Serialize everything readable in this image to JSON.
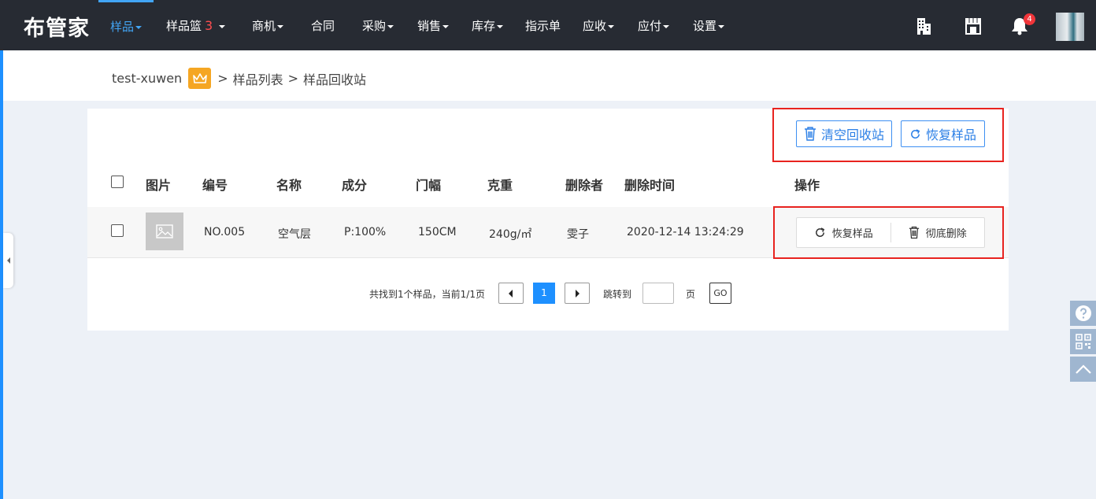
{
  "app": {
    "logo": "布管家"
  },
  "nav": {
    "items": [
      {
        "label": "样品",
        "caret": true,
        "active": true
      },
      {
        "label": "样品篮",
        "badge": "3",
        "caret": true
      },
      {
        "label": "商机",
        "caret": true
      },
      {
        "label": "合同",
        "caret": false
      },
      {
        "label": "采购",
        "caret": true
      },
      {
        "label": "销售",
        "caret": true
      },
      {
        "label": "库存",
        "caret": true
      },
      {
        "label": "指示单",
        "caret": false
      },
      {
        "label": "应收",
        "caret": true
      },
      {
        "label": "应付",
        "caret": true
      },
      {
        "label": "设置",
        "caret": true
      }
    ],
    "icons": [
      "building-icon",
      "store-icon",
      "bell-icon"
    ],
    "notification_count": "4"
  },
  "breadcrumb": {
    "user": "test-xuwen",
    "sep1": ">",
    "list": "样品列表",
    "sep2": ">",
    "current": "样品回收站"
  },
  "toolbar": {
    "clear_label": "清空回收站",
    "restore_label": "恢复样品"
  },
  "table": {
    "headers": [
      "图片",
      "编号",
      "名称",
      "成分",
      "门幅",
      "克重",
      "删除者",
      "删除时间",
      "操作"
    ],
    "rows": [
      {
        "code": "NO.005",
        "name": "空气层",
        "composition": "P:100%",
        "width": "150CM",
        "weight": "240g/㎡",
        "deleted_by": "雯子",
        "deleted_at": "2020-12-14 13:24:29",
        "restore_label": "恢复样品",
        "delete_label": "彻底删除"
      }
    ]
  },
  "pagination": {
    "summary": "共找到1个样品，当前1/1页",
    "current_page": "1",
    "jump_label": "跳转到",
    "page_unit": "页",
    "go_label": "GO"
  },
  "colors": {
    "accent": "#1e90ff",
    "highlight_border": "#e8231f",
    "nav_bg": "#272b33"
  }
}
